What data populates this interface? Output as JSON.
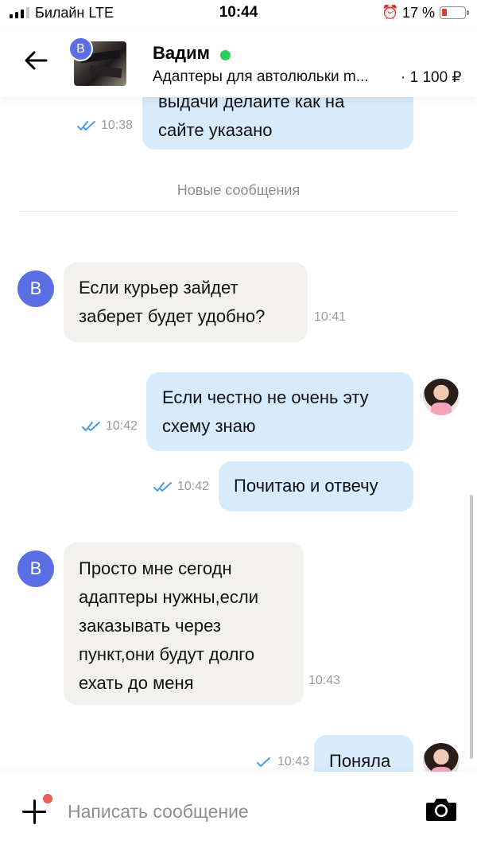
{
  "status_bar": {
    "carrier": "Билайн  LTE",
    "time": "10:44",
    "battery_percent": "17 %",
    "battery_color": "#e8372f"
  },
  "header": {
    "back_icon": "arrow-left-icon",
    "seller_initial": "В",
    "name": "Вадим",
    "online_color": "#2ecc5b",
    "listing_title": "Адаптеры для автолюльки m...",
    "price": "· 1 100 ₽"
  },
  "messages": [
    {
      "direction": "out",
      "lines": [
        "выдачи делайте как на",
        "сайте указано"
      ],
      "time": "10:38",
      "read": true
    },
    {
      "direction": "in",
      "avatar_initial": "В",
      "lines": [
        "Если курьер зайдет",
        "заберет будет удобно?"
      ],
      "time": "10:41"
    },
    {
      "direction": "out",
      "lines": [
        "Если честно не очень эту",
        "схему знаю"
      ],
      "time": "10:42",
      "read": true
    },
    {
      "direction": "out",
      "lines": [
        "Почитаю и отвечу"
      ],
      "time": "10:42",
      "read": true
    },
    {
      "direction": "in",
      "avatar_initial": "В",
      "lines": [
        "Просто мне сегодн",
        "адаптеры нужны,если",
        "заказывать через",
        "пункт,они будут долго",
        "ехать до меня"
      ],
      "time": "10:43"
    },
    {
      "direction": "out",
      "lines": [
        "Поняла"
      ],
      "time": "10:43",
      "read": true
    }
  ],
  "new_messages_label": "Новые сообщения",
  "composer": {
    "placeholder": "Написать сообщение",
    "attach_icon": "plus-icon",
    "camera_icon": "camera-icon",
    "notification_dot_color": "#ef5b57"
  },
  "colors": {
    "incoming_bubble": "#f2f1ed",
    "outgoing_bubble": "#d6ebfb",
    "avatar": "#5b6ee3",
    "read_ticks": "#4a9be0"
  }
}
